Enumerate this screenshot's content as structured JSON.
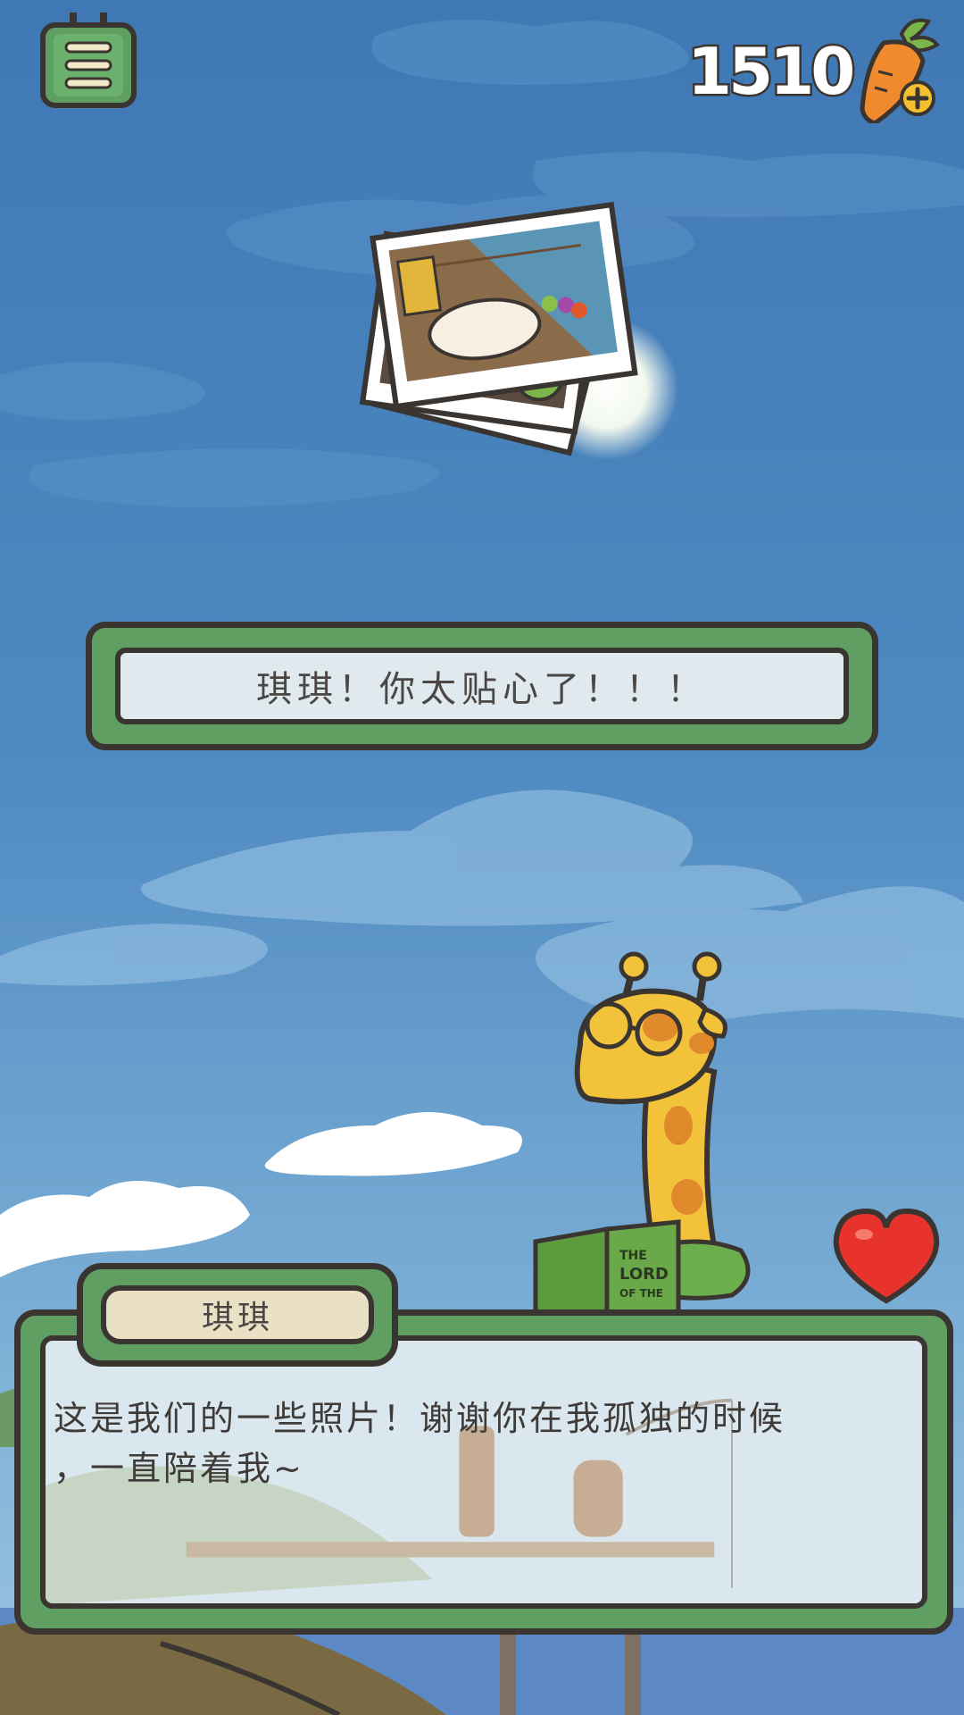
{
  "hud": {
    "carrot_count": "1510",
    "menu_icon": "menu-list-icon",
    "carrot_icon": "carrot-plus-icon"
  },
  "photos": {
    "icon": "photo-stack-icon"
  },
  "banner": {
    "text": "琪琪！你太贴心了！！！"
  },
  "dialog": {
    "speaker": "琪琪",
    "line1": "这是我们的一些照片！谢谢你在我孤独的时候",
    "line2": "，一直陪着我~"
  },
  "heart": {
    "icon": "heart-icon"
  },
  "colors": {
    "sky_top": "#3f7bb8",
    "sky_bottom": "#79aed6",
    "frame_green": "#5fa062",
    "outline": "#3a3531",
    "banner_fill": "#dfe9ee",
    "name_fill": "#e9e0c6",
    "heart_red": "#e8332c"
  }
}
